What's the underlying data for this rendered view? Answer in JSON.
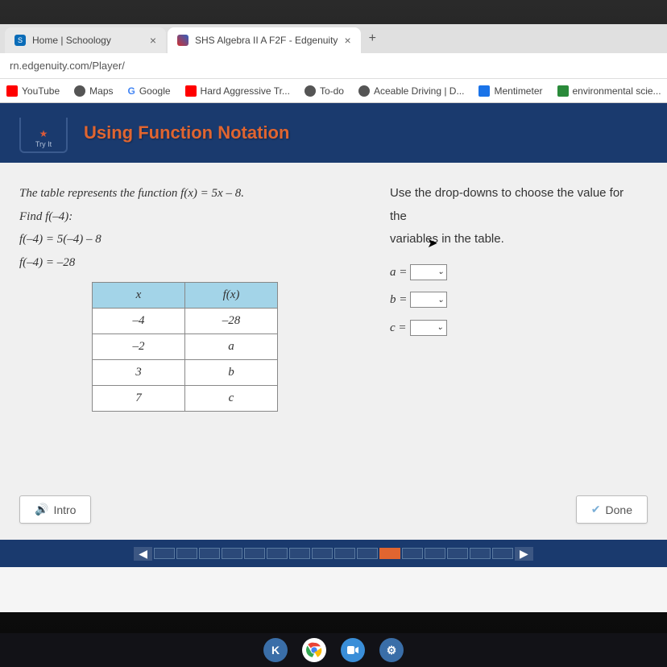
{
  "tabs": [
    {
      "title": "Home | Schoology",
      "icon_color": "#0a6cb8"
    },
    {
      "title": "SHS Algebra II A F2F - Edgenuity",
      "icon_color": "#d03030"
    }
  ],
  "url": "rn.edgenuity.com/Player/",
  "bookmarks": [
    {
      "label": "YouTube",
      "icon": "#ff0000"
    },
    {
      "label": "Maps",
      "icon": "#555"
    },
    {
      "label": "Google",
      "icon": "#4285f4"
    },
    {
      "label": "Hard Aggressive Tr...",
      "icon": "#ff0000"
    },
    {
      "label": "To-do",
      "icon": "#555"
    },
    {
      "label": "Aceable Driving | D...",
      "icon": "#555"
    },
    {
      "label": "Mentimeter",
      "icon": "#1a73e8"
    },
    {
      "label": "environmental scie...",
      "icon": "#2a8a3a"
    }
  ],
  "tryit_label": "Try It",
  "lesson_title": "Using Function Notation",
  "left": {
    "line1": "The table represents the function f(x) = 5x – 8.",
    "line2": "Find f(–4):",
    "line3": "f(–4) = 5(–4) – 8",
    "line4": "f(–4) = –28"
  },
  "right": {
    "prompt1": "Use the drop-downs to choose the value for the",
    "prompt2": "variables in the table.",
    "a_label": "a =",
    "b_label": "b =",
    "c_label": "c ="
  },
  "table": {
    "h1": "x",
    "h2": "f(x)",
    "rows": [
      {
        "x": "–4",
        "fx": "–28"
      },
      {
        "x": "–2",
        "fx": "a"
      },
      {
        "x": "3",
        "fx": "b"
      },
      {
        "x": "7",
        "fx": "c"
      }
    ]
  },
  "buttons": {
    "intro": "Intro",
    "done": "Done"
  },
  "progress": {
    "segments": 16,
    "active_index": 10
  }
}
